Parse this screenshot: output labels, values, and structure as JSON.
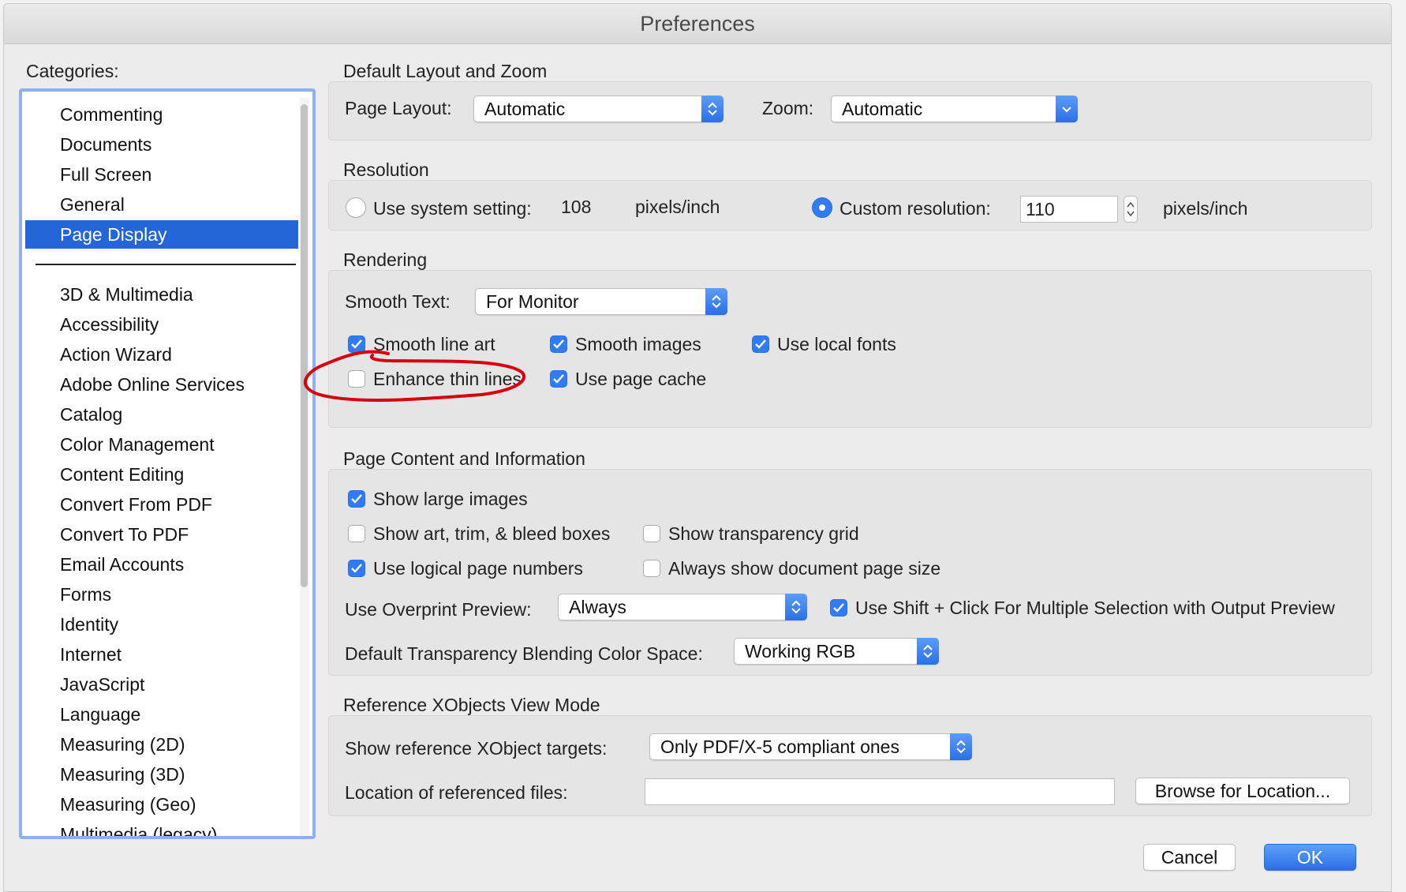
{
  "window": {
    "title": "Preferences"
  },
  "sidebar": {
    "label": "Categories:",
    "selected_index": 4,
    "top_items": [
      "Commenting",
      "Documents",
      "Full Screen",
      "General",
      "Page Display"
    ],
    "items": [
      "3D & Multimedia",
      "Accessibility",
      "Action Wizard",
      "Adobe Online Services",
      "Catalog",
      "Color Management",
      "Content Editing",
      "Convert From PDF",
      "Convert To PDF",
      "Email Accounts",
      "Forms",
      "Identity",
      "Internet",
      "JavaScript",
      "Language",
      "Measuring (2D)",
      "Measuring (3D)",
      "Measuring (Geo)",
      "Multimedia (legacy)"
    ]
  },
  "layout_zoom": {
    "heading": "Default Layout and Zoom",
    "page_layout_label": "Page Layout:",
    "page_layout_value": "Automatic",
    "zoom_label": "Zoom:",
    "zoom_value": "Automatic"
  },
  "resolution": {
    "heading": "Resolution",
    "system_label": "Use system setting:",
    "system_value": "108",
    "system_unit": "pixels/inch",
    "custom_label": "Custom resolution:",
    "custom_value": "110",
    "custom_unit": "pixels/inch",
    "custom_selected": true
  },
  "rendering": {
    "heading": "Rendering",
    "smooth_text_label": "Smooth Text:",
    "smooth_text_value": "For Monitor",
    "smooth_line_art": "Smooth line art",
    "smooth_images": "Smooth images",
    "use_local_fonts": "Use local fonts",
    "enhance_thin_lines": "Enhance thin lines",
    "use_page_cache": "Use page cache"
  },
  "page_content": {
    "heading": "Page Content and Information",
    "show_large_images": "Show large images",
    "show_art_trim": "Show art, trim, & bleed boxes",
    "show_transparency_grid": "Show transparency grid",
    "use_logical_page_numbers": "Use logical page numbers",
    "always_show_page_size": "Always show document page size",
    "overprint_label": "Use Overprint Preview:",
    "overprint_value": "Always",
    "shift_click": "Use Shift + Click For Multiple Selection with Output Preview",
    "blending_label": "Default Transparency Blending Color Space:",
    "blending_value": "Working RGB"
  },
  "xobjects": {
    "heading": "Reference XObjects View Mode",
    "targets_label": "Show reference XObject targets:",
    "targets_value": "Only PDF/X-5 compliant ones",
    "location_label": "Location of referenced files:",
    "location_value": "",
    "browse_button": "Browse for Location..."
  },
  "footer": {
    "cancel": "Cancel",
    "ok": "OK"
  },
  "colors": {
    "accent": "#2f7cf6",
    "selection": "#2465d8",
    "annotation": "#d8000f"
  }
}
